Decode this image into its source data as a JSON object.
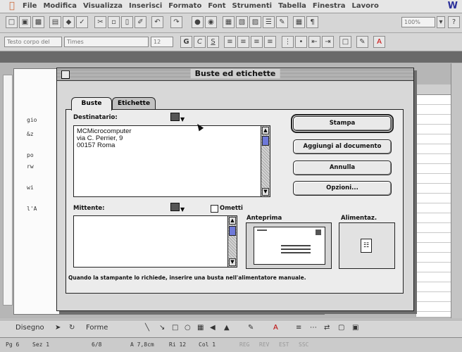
{
  "menubar": {
    "items": [
      "File",
      "Modifica",
      "Visualizza",
      "Inserisci",
      "Formato",
      "Font",
      "Strumenti",
      "Tabella",
      "Finestra",
      "Lavoro"
    ]
  },
  "toolbar": {
    "zoom": "100%"
  },
  "formatting_bar": {
    "style": "Testo corpo del",
    "font": "Times",
    "size": "12",
    "bold": "G",
    "italic": "C",
    "underline": "S"
  },
  "document": {
    "fragments": [
      "gio",
      "&z",
      "po",
      "rw",
      "wi",
      "l'A"
    ]
  },
  "dialog": {
    "title": "Buste ed etichette",
    "tabs": [
      {
        "label": "Buste"
      },
      {
        "label": "Etichette"
      }
    ],
    "recipient_label": "Destinatario:",
    "recipient_text": "MCMicrocomputer\nvia C. Perrier, 9\n00157 Roma",
    "sender_label": "Mittente:",
    "sender_text": "",
    "omit_label": "Ometti",
    "preview_label": "Anteprima",
    "feed_label": "Alimentaz.",
    "buttons": {
      "print": "Stampa",
      "add": "Aggiungi al documento",
      "cancel": "Annulla",
      "options": "Opzioni..."
    },
    "info_text": "Quando la stampante lo richiede, inserire una busta nell'alimentatore manuale."
  },
  "drawing_bar": {
    "draw": "Disegno",
    "shapes": "Forme"
  },
  "statusbar": {
    "page": "Pg 6",
    "section": "Sez 1",
    "pages": "6/8",
    "position": "A 7,8cm",
    "row": "Ri 12",
    "col": "Col 1",
    "modes": [
      "REG",
      "REV",
      "EST",
      "SSC"
    ]
  },
  "colors": {
    "scroll_thumb": "#6e79d9",
    "apple": "#cc6633"
  }
}
